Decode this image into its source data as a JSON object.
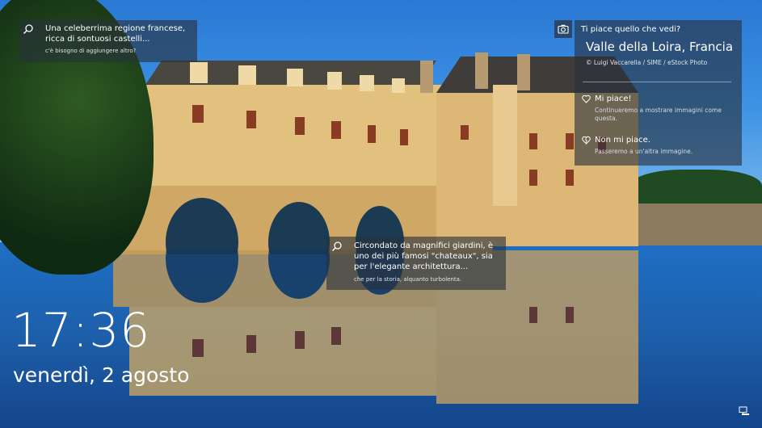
{
  "hint_top_left": {
    "title": "Una celeberrima regione francese, ricca di sontuosi castelli...",
    "subtitle": "c'è bisogno di aggiungere altro?",
    "icon": "search-icon"
  },
  "hint_center": {
    "title": "Circondato da magnifici giardini, è uno dei più famosi \"chateaux\", sia per l'elegante architettura...",
    "subtitle": "che per la storia, alquanto turbolenta.",
    "icon": "search-icon"
  },
  "spotlight": {
    "question": "Ti piace quello che vedi?",
    "location": "Valle della Loira, Francia",
    "credit": "© Luigi Vaccarella / SIME / eStock Photo",
    "like_label": "Mi piace!",
    "like_desc": "Continueremo a mostrare immagini come questa.",
    "dislike_label": "Non mi piace.",
    "dislike_desc": "Passeremo a un'altra immagine.",
    "camera_icon": "camera-icon",
    "heart_icon": "heart-icon"
  },
  "clock": {
    "time": "17:36",
    "date": "venerdì, 2 agosto"
  },
  "status": {
    "network_icon": "network-icon"
  },
  "colors": {
    "sky": "#2a78d4",
    "water": "#1d5faa",
    "panel": "#28303c",
    "castle": "#e6c483"
  }
}
